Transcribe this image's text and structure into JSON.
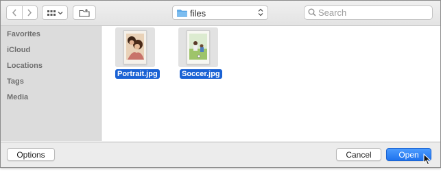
{
  "toolbar": {
    "back_icon": "chevron-left-icon",
    "forward_icon": "chevron-right-icon",
    "view_icon": "icon-grid-icon",
    "new_folder_icon": "new-folder-icon",
    "location": {
      "label": "files",
      "icon": "folder-icon"
    },
    "search": {
      "placeholder": "Search",
      "value": ""
    }
  },
  "sidebar": {
    "sections": [
      {
        "label": "Favorites"
      },
      {
        "label": "iCloud"
      },
      {
        "label": "Locations"
      },
      {
        "label": "Tags"
      },
      {
        "label": "Media"
      }
    ]
  },
  "files": [
    {
      "name": "Portrait.jpg",
      "selected": true,
      "thumbnail": "portrait-photo"
    },
    {
      "name": "Soccer.jpg",
      "selected": true,
      "thumbnail": "soccer-photo"
    }
  ],
  "footer": {
    "options_label": "Options",
    "cancel_label": "Cancel",
    "open_label": "Open"
  },
  "colors": {
    "selection": "#1a62d4",
    "accent": "#2a7df5",
    "folder": "#5aa9e8",
    "sidebar_bg": "#dcdcdc"
  }
}
